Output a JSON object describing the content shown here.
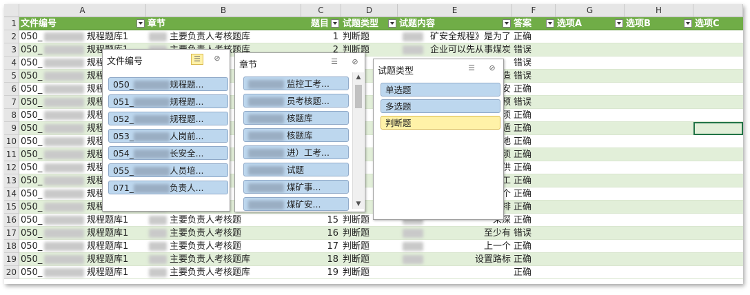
{
  "columns": [
    "A",
    "B",
    "C",
    "D",
    "E",
    "F",
    "G",
    "H"
  ],
  "header_row": {
    "file_no": "文件编号",
    "chapter": "章节",
    "item": "题目",
    "type": "试题类型",
    "content": "试题内容",
    "answer": "答案",
    "opt_a": "选项A",
    "opt_b": "选项B",
    "opt_c": "选项C"
  },
  "rows": [
    {
      "r": "2",
      "a": "050_",
      "a2": "规程题库1",
      "b": "主要负责人考核题库",
      "c": "1",
      "d": "判断题",
      "e": "矿安全规程》是为了",
      "f": "正确"
    },
    {
      "r": "3",
      "a": "050_",
      "a2": "规程题库1",
      "b": "主要负责人考核题库",
      "c": "2",
      "d": "判断题",
      "e": "企业可以先从事煤炭",
      "f": "错误"
    },
    {
      "r": "4",
      "a": "050_",
      "a2": "规程",
      "b": "",
      "c": "",
      "d": "",
      "e": "",
      "f": "错误"
    },
    {
      "r": "5",
      "a": "050_",
      "a2": "规程",
      "b": "",
      "c": "",
      "d": "",
      "e": "造",
      "f": "错误"
    },
    {
      "r": "6",
      "a": "050_",
      "a2": "规程",
      "b": "",
      "c": "",
      "d": "",
      "e": "安",
      "f": "正确"
    },
    {
      "r": "7",
      "a": "050_",
      "a2": "规程",
      "b": "",
      "c": "",
      "d": "",
      "e": "预",
      "f": "错误"
    },
    {
      "r": "8",
      "a": "050_",
      "a2": "规程",
      "b": "",
      "c": "",
      "d": "",
      "e": "须",
      "f": "正确"
    },
    {
      "r": "9",
      "a": "050_",
      "a2": "规程",
      "b": "",
      "c": "",
      "d": "",
      "e": "遁",
      "f": "正确"
    },
    {
      "r": "10",
      "a": "050_",
      "a2": "规程",
      "b": "",
      "c": "",
      "d": "",
      "e": "地",
      "f": "正确"
    },
    {
      "r": "11",
      "a": "050_",
      "a2": "规程",
      "b": "",
      "c": "",
      "d": "",
      "e": "须",
      "f": "正确"
    },
    {
      "r": "12",
      "a": "050_",
      "a2": "规程",
      "b": "",
      "c": "",
      "d": "",
      "e": "供",
      "f": "正确"
    },
    {
      "r": "13",
      "a": "050_",
      "a2": "规程",
      "b": "",
      "c": "",
      "d": "",
      "e": "工",
      "f": "正确"
    },
    {
      "r": "14",
      "a": "050_",
      "a2": "规程",
      "b": "",
      "c": "",
      "d": "",
      "e": "个",
      "f": "正确"
    },
    {
      "r": "15",
      "a": "050_",
      "a2": "规程",
      "b": "",
      "c": "",
      "d": "",
      "e": "排",
      "f": "正确"
    },
    {
      "r": "16",
      "a": "050_",
      "a2": "规程题库1",
      "b": "主要负责人考核题",
      "c": "15",
      "d": "判断题",
      "e": "采深",
      "f": "正确"
    },
    {
      "r": "17",
      "a": "050_",
      "a2": "规程题库1",
      "b": "主要负责人考核题",
      "c": "16",
      "d": "判断题",
      "e": "至少有",
      "f": "错误"
    },
    {
      "r": "18",
      "a": "050_",
      "a2": "规程题库1",
      "b": "主要负责人考核题",
      "c": "17",
      "d": "判断题",
      "e": "上一个",
      "f": "正确"
    },
    {
      "r": "19",
      "a": "050_",
      "a2": "规程题库1",
      "b": "主要负责人考核题库",
      "c": "18",
      "d": "判断题",
      "e": "设置路标",
      "f": "正确"
    },
    {
      "r": "20",
      "a": "050_",
      "a2": "规程题库1",
      "b": "主要负责人考核题库",
      "c": "19",
      "d": "判断题",
      "e": "",
      "f": "正确"
    }
  ],
  "slicer_file": {
    "title": "文件编号",
    "items": [
      "050_",
      "051_",
      "052_",
      "053_",
      "054_",
      "055_",
      "071_"
    ],
    "suffix": [
      "规程题...",
      "规程题...",
      "规程题...",
      "人岗前...",
      "长安全...",
      "人员培...",
      "负责人..."
    ]
  },
  "slicer_chapter": {
    "title": "章节",
    "items": [
      "监控工考...",
      "员考核题...",
      "核题库",
      "核题库",
      "进）工考...",
      "试题",
      "煤矿事...",
      "煤矿安..."
    ]
  },
  "slicer_type": {
    "title": "试题类型",
    "items": [
      "单选题",
      "多选题",
      "判断题"
    ],
    "selected": 2
  },
  "colors": {
    "header_green": "#70ad47",
    "band_green": "#e2efd9",
    "slicer_item": "#bdd7ee",
    "slicer_selected": "#fff2a8"
  }
}
